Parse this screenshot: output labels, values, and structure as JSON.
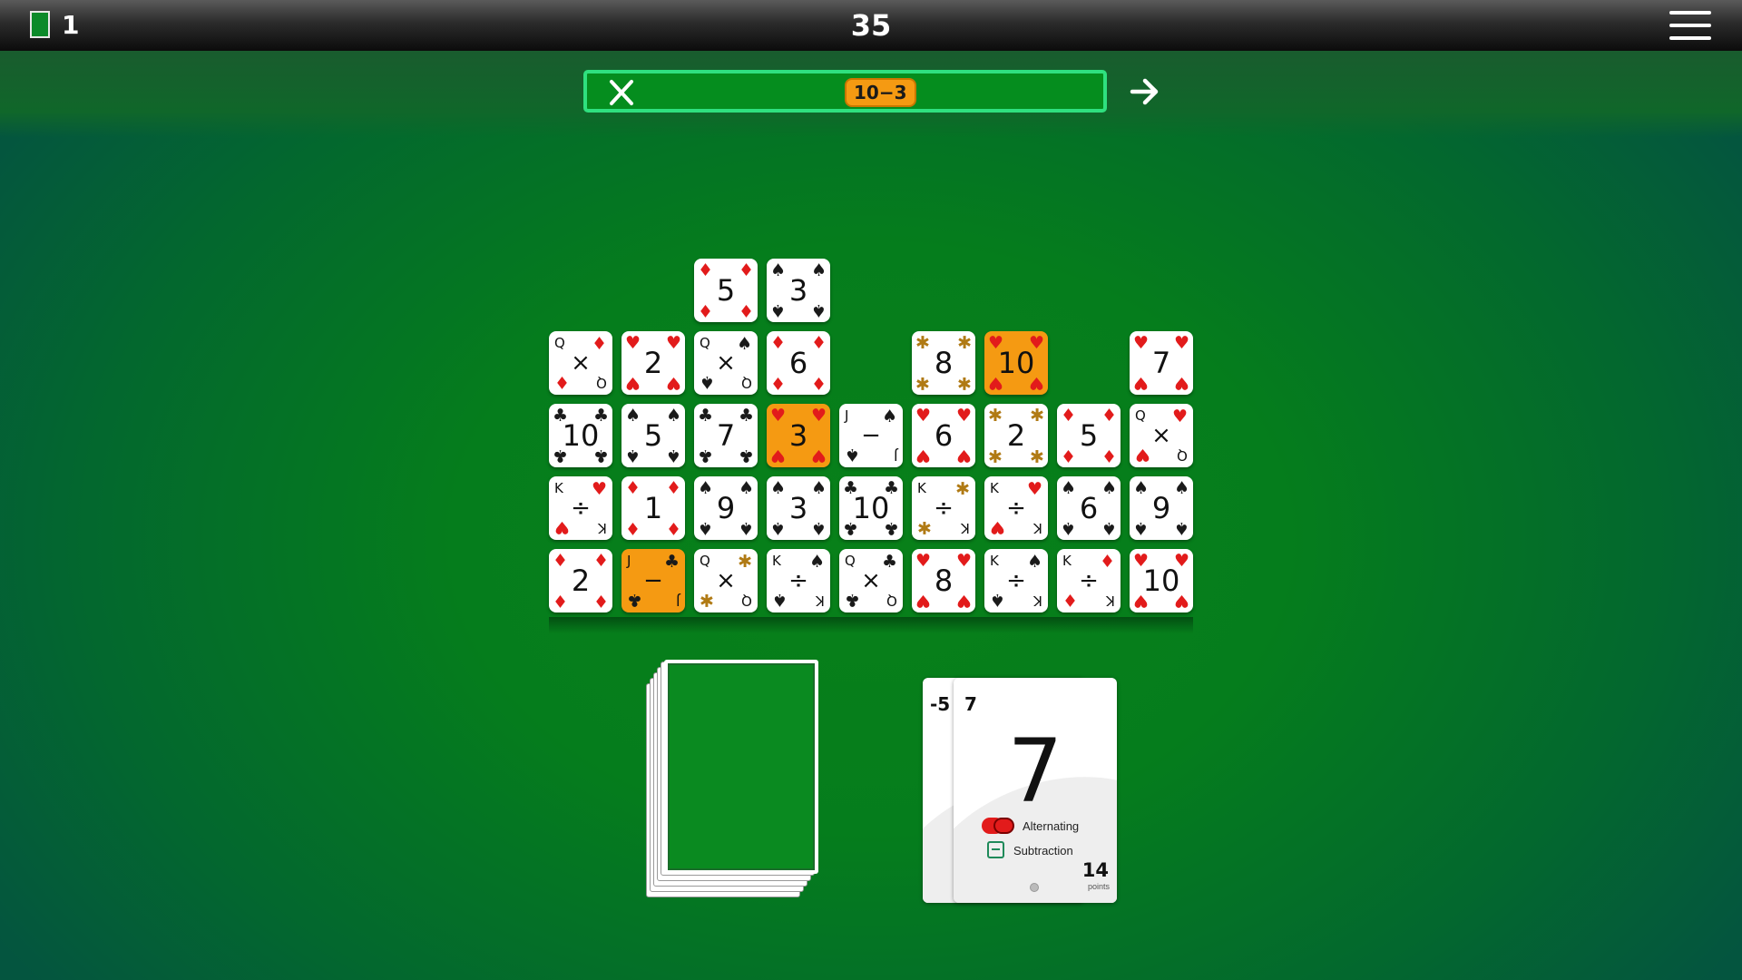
{
  "topbar": {
    "deck_count": "1",
    "score": "35",
    "menu_icon": "hamburger-menu-icon",
    "deck_icon": "deck-icon"
  },
  "expression": {
    "text": "10−3",
    "clear_icon": "close-icon",
    "next_icon": "arrow-right-icon"
  },
  "colors": {
    "selected": "#f59a12",
    "red_suit": "#e21b1b",
    "black_suit": "#1a1a1a",
    "felt": "#057d1c",
    "expr_border": "#2fe07f"
  },
  "board": [
    {
      "rank": "5",
      "suit": "diamonds",
      "selected": false
    },
    {
      "rank": "3",
      "suit": "spades",
      "selected": false
    },
    {
      "rank": "Q",
      "op": "×",
      "suit": "diamonds",
      "selected": false
    },
    {
      "rank": "2",
      "suit": "hearts",
      "selected": false
    },
    {
      "rank": "Q",
      "op": "×",
      "suit": "spades",
      "selected": false
    },
    {
      "rank": "6",
      "suit": "diamonds",
      "selected": false
    },
    {
      "rank": "8",
      "suit": "bees",
      "selected": false
    },
    {
      "rank": "10",
      "suit": "hearts",
      "selected": true
    },
    {
      "rank": "7",
      "suit": "hearts",
      "selected": false
    },
    {
      "rank": "10",
      "suit": "clubs",
      "selected": false
    },
    {
      "rank": "5",
      "suit": "spades",
      "selected": false
    },
    {
      "rank": "7",
      "suit": "clubs",
      "selected": false
    },
    {
      "rank": "3",
      "suit": "hearts",
      "selected": true
    },
    {
      "rank": "J",
      "op": "−",
      "suit": "spades",
      "selected": false
    },
    {
      "rank": "6",
      "suit": "hearts",
      "selected": false
    },
    {
      "rank": "2",
      "suit": "bees",
      "selected": false
    },
    {
      "rank": "5",
      "suit": "diamonds",
      "selected": false
    },
    {
      "rank": "Q",
      "op": "×",
      "suit": "hearts",
      "selected": false
    },
    {
      "rank": "K",
      "op": "÷",
      "suit": "hearts",
      "selected": false
    },
    {
      "rank": "1",
      "suit": "diamonds",
      "selected": false
    },
    {
      "rank": "9",
      "suit": "spades",
      "selected": false
    },
    {
      "rank": "3",
      "suit": "spades",
      "selected": false
    },
    {
      "rank": "10",
      "suit": "clubs",
      "selected": false
    },
    {
      "rank": "K",
      "op": "÷",
      "suit": "bees",
      "selected": false
    },
    {
      "rank": "K",
      "op": "÷",
      "suit": "hearts",
      "selected": false
    },
    {
      "rank": "6",
      "suit": "spades",
      "selected": false
    },
    {
      "rank": "9",
      "suit": "spades",
      "selected": false
    },
    {
      "rank": "2",
      "suit": "diamonds",
      "selected": false
    },
    {
      "rank": "J",
      "op": "−",
      "suit": "clubs",
      "selected": true
    },
    {
      "rank": "Q",
      "op": "×",
      "suit": "bees",
      "selected": false
    },
    {
      "rank": "K",
      "op": "÷",
      "suit": "spades",
      "selected": false
    },
    {
      "rank": "Q",
      "op": "×",
      "suit": "clubs",
      "selected": false
    },
    {
      "rank": "8",
      "suit": "hearts",
      "selected": false
    },
    {
      "rank": "K",
      "op": "÷",
      "suit": "spades",
      "selected": false
    },
    {
      "rank": "K",
      "op": "÷",
      "suit": "diamonds",
      "selected": false
    },
    {
      "rank": "10",
      "suit": "hearts",
      "selected": false
    }
  ],
  "pile": {
    "under_value": "-5",
    "top_value": "7",
    "big_value": "7",
    "rule1": "Alternating",
    "rule1_icon": "alternating-icon",
    "rule2": "Subtraction",
    "rule2_icon": "subtraction-icon",
    "points": "14",
    "points_label": "points"
  }
}
